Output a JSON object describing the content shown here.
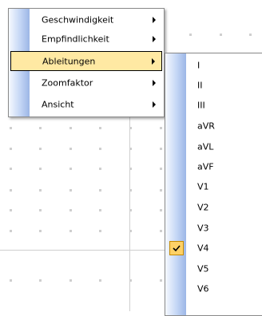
{
  "main_menu": {
    "items": [
      {
        "label": "Geschwindigkeit",
        "has_submenu": true
      },
      {
        "label": "Empfindlichkeit",
        "has_submenu": true
      },
      {
        "label": "Ableitungen",
        "has_submenu": true,
        "highlighted": true
      },
      {
        "label": "Zoomfaktor",
        "has_submenu": true
      },
      {
        "label": "Ansicht",
        "has_submenu": true
      }
    ]
  },
  "leads_menu": {
    "items": [
      {
        "label": "I"
      },
      {
        "label": "II"
      },
      {
        "label": "III"
      },
      {
        "label": "aVR"
      },
      {
        "label": "aVL"
      },
      {
        "label": "aVF"
      },
      {
        "label": "V1"
      },
      {
        "label": "V2"
      },
      {
        "label": "V3"
      },
      {
        "label": "V4",
        "checked": true
      },
      {
        "label": "V5"
      },
      {
        "label": "V6"
      }
    ]
  },
  "colors": {
    "highlight": "#ffe9a3",
    "check": "#ffd166",
    "grid": "#cfcfcf"
  }
}
